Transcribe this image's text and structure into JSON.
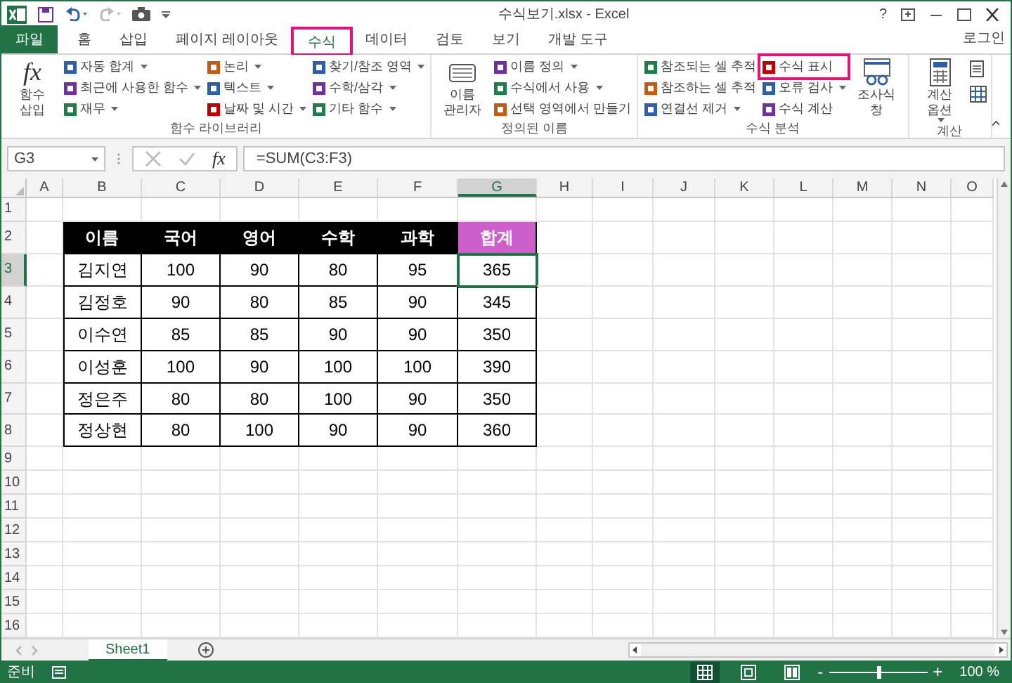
{
  "window": {
    "title": "수식보기.xlsx - Excel",
    "help": "?"
  },
  "file_button": "파일",
  "tabs": [
    {
      "label": "홈",
      "selected": false,
      "highlighted": false
    },
    {
      "label": "삽입",
      "selected": false,
      "highlighted": false
    },
    {
      "label": "페이지 레이아웃",
      "selected": false,
      "highlighted": false
    },
    {
      "label": "수식",
      "selected": true,
      "highlighted": true
    },
    {
      "label": "데이터",
      "selected": false,
      "highlighted": false
    },
    {
      "label": "검토",
      "selected": false,
      "highlighted": false
    },
    {
      "label": "보기",
      "selected": false,
      "highlighted": false
    },
    {
      "label": "개발 도구",
      "selected": false,
      "highlighted": false
    }
  ],
  "sign_in": "로그인",
  "ribbon": [
    {
      "label": "함수 라이브러리",
      "large": [
        {
          "symbol": "fx",
          "label": "함수 삽입",
          "dropdown": false
        }
      ],
      "columns": [
        [
          {
            "label": "자동 합계",
            "dropdown": true,
            "highlighted": false
          },
          {
            "label": "최근에 사용한 함수",
            "dropdown": true,
            "highlighted": false
          },
          {
            "label": "재무",
            "dropdown": true,
            "highlighted": false
          }
        ],
        [
          {
            "label": "논리",
            "dropdown": true,
            "highlighted": false
          },
          {
            "label": "텍스트",
            "dropdown": true,
            "highlighted": false
          },
          {
            "label": "날짜 및 시간",
            "dropdown": true,
            "highlighted": false
          }
        ],
        [
          {
            "label": "찾기/참조 영역",
            "dropdown": true,
            "highlighted": false
          },
          {
            "label": "수학/삼각",
            "dropdown": true,
            "highlighted": false
          },
          {
            "label": "기타 함수",
            "dropdown": true,
            "highlighted": false
          }
        ]
      ]
    },
    {
      "label": "정의된 이름",
      "large": [
        {
          "label": "이름 관리자",
          "dropdown": false
        }
      ],
      "columns": [
        [
          {
            "label": "이름 정의",
            "dropdown": true,
            "highlighted": false
          },
          {
            "label": "수식에서 사용",
            "dropdown": true,
            "highlighted": false
          },
          {
            "label": "선택 영역에서 만들기",
            "dropdown": false,
            "highlighted": false
          }
        ]
      ]
    },
    {
      "label": "수식 분석",
      "columns": [
        [
          {
            "label": "참조되는 셀 추적",
            "dropdown": false,
            "highlighted": false
          },
          {
            "label": "참조하는 셀 추적",
            "dropdown": false,
            "highlighted": false
          },
          {
            "label": "연결선 제거",
            "dropdown": true,
            "highlighted": false
          }
        ],
        [
          {
            "label": "수식 표시",
            "dropdown": false,
            "highlighted": true
          },
          {
            "label": "오류 검사",
            "dropdown": true,
            "highlighted": false
          },
          {
            "label": "수식 계산",
            "dropdown": false,
            "highlighted": false
          }
        ]
      ],
      "after": [
        {
          "label": "조사식 창",
          "dropdown": false
        }
      ]
    },
    {
      "label": "계산",
      "large": [
        {
          "label": "계산 옵션",
          "dropdown": true
        }
      ]
    }
  ],
  "formula_bar": {
    "name_box": "G3",
    "fx_button": "fx",
    "formula": "=SUM(C3:F3)"
  },
  "sheet": {
    "columns": [
      {
        "label": "A",
        "selected": false
      },
      {
        "label": "B",
        "selected": false
      },
      {
        "label": "C",
        "selected": false
      },
      {
        "label": "D",
        "selected": false
      },
      {
        "label": "E",
        "selected": false
      },
      {
        "label": "F",
        "selected": false
      },
      {
        "label": "G",
        "selected": true
      },
      {
        "label": "H",
        "selected": false
      },
      {
        "label": "I",
        "selected": false
      },
      {
        "label": "J",
        "selected": false
      },
      {
        "label": "K",
        "selected": false
      },
      {
        "label": "L",
        "selected": false
      },
      {
        "label": "M",
        "selected": false
      },
      {
        "label": "N",
        "selected": false
      },
      {
        "label": "O",
        "selected": false
      }
    ],
    "rows": [
      {
        "label": "1",
        "selected": false
      },
      {
        "label": "2",
        "selected": false
      },
      {
        "label": "3",
        "selected": true
      },
      {
        "label": "4",
        "selected": false
      },
      {
        "label": "5",
        "selected": false
      },
      {
        "label": "6",
        "selected": false
      },
      {
        "label": "7",
        "selected": false
      },
      {
        "label": "8",
        "selected": false
      },
      {
        "label": "9",
        "selected": false
      },
      {
        "label": "10",
        "selected": false
      },
      {
        "label": "11",
        "selected": false
      },
      {
        "label": "12",
        "selected": false
      },
      {
        "label": "13",
        "selected": false
      },
      {
        "label": "14",
        "selected": false
      },
      {
        "label": "15",
        "selected": false
      },
      {
        "label": "16",
        "selected": false
      }
    ],
    "table": {
      "header": [
        {
          "text": "이름",
          "accent": false
        },
        {
          "text": "국어",
          "accent": false
        },
        {
          "text": "영어",
          "accent": false
        },
        {
          "text": "수학",
          "accent": false
        },
        {
          "text": "과학",
          "accent": false
        },
        {
          "text": "합계",
          "accent": true
        }
      ],
      "rows": [
        [
          "김지연",
          "100",
          "90",
          "80",
          "95",
          "365"
        ],
        [
          "김정호",
          "90",
          "80",
          "85",
          "90",
          "345"
        ],
        [
          "이수연",
          "85",
          "85",
          "90",
          "90",
          "350"
        ],
        [
          "이성훈",
          "100",
          "90",
          "100",
          "100",
          "390"
        ],
        [
          "정은주",
          "80",
          "80",
          "100",
          "90",
          "350"
        ],
        [
          "정상현",
          "80",
          "100",
          "90",
          "90",
          "360"
        ]
      ]
    }
  },
  "sheet_tabs": [
    {
      "label": "Sheet1",
      "selected": true
    }
  ],
  "status_bar": {
    "status": "준비",
    "views": [
      {
        "kind": "normal",
        "selected": true
      },
      {
        "kind": "layout",
        "selected": false
      },
      {
        "kind": "break",
        "selected": false
      }
    ],
    "zoom_out": "-",
    "zoom_slider": {
      "level": 0.5
    },
    "zoom_in": "+",
    "zoom": "100 %"
  }
}
